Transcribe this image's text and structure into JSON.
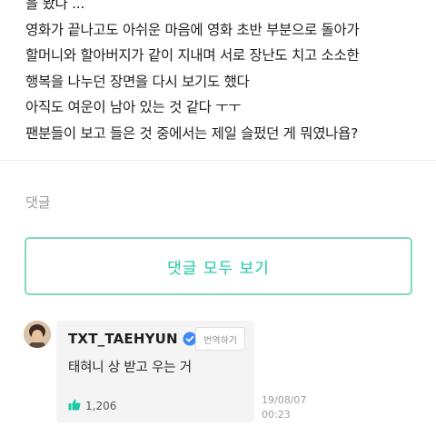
{
  "post": {
    "lines": [
      "을 봤다 ...",
      "영화가 끝나고도 아쉬운 마음에 영화 초반 부분으로 돌아가",
      "할머니와 할아버지가 같이 지내며 서로 장난도 치고 소소한",
      "행복을 나누던 장면을 다시 보기도 했다",
      "아직도 여운이 남아 있는 것 같다 ㅜㅜ",
      "팬분들이 보고 들은 것 중에서는 제일 슬펐던 게 뭐였나욥?"
    ]
  },
  "comments_section": {
    "label": "댓글",
    "view_all_label": "댓글 모두 보기"
  },
  "comment": {
    "author": "TXT_TAEHYUN",
    "translate_label": "번역하기",
    "text": "태혀니 상 받고 우는 거",
    "likes": "1,206",
    "date": "19/08/07",
    "time": "00:23"
  },
  "colors": {
    "accent": "#18c9a4",
    "button_border": "#7fdcc0",
    "verified": "#3d8af7"
  }
}
